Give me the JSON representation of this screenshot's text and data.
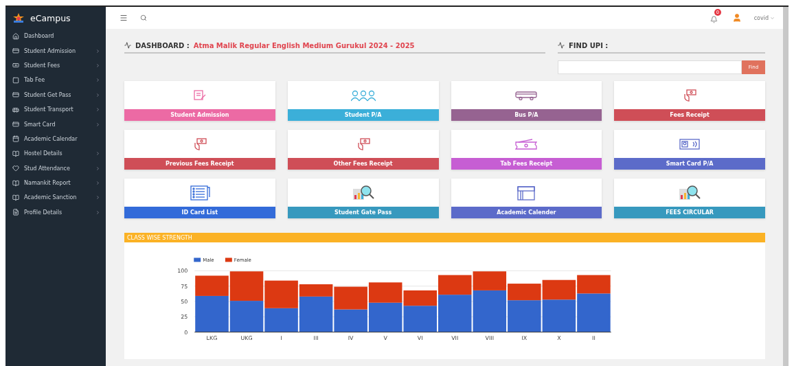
{
  "brand": "eCampus",
  "sidebar": {
    "items": [
      {
        "label": "Dashboard",
        "has_submenu": false
      },
      {
        "label": "Student Admission",
        "has_submenu": true
      },
      {
        "label": "Student Fees",
        "has_submenu": true
      },
      {
        "label": "Tab Fee",
        "has_submenu": true
      },
      {
        "label": "Student Get Pass",
        "has_submenu": true
      },
      {
        "label": "Student Transport",
        "has_submenu": true
      },
      {
        "label": "Smart Card",
        "has_submenu": true
      },
      {
        "label": "Academic Calendar",
        "has_submenu": false
      },
      {
        "label": "Hostel Details",
        "has_submenu": true
      },
      {
        "label": "Stud Attendance",
        "has_submenu": true
      },
      {
        "label": "Namankit Report",
        "has_submenu": true
      },
      {
        "label": "Academic Sanction",
        "has_submenu": true
      },
      {
        "label": "Profile Details",
        "has_submenu": true
      }
    ]
  },
  "topbar": {
    "notification_count": "0",
    "user": "covid"
  },
  "dashboard_heading": {
    "label": "DASHBOARD :",
    "school": "Atma Malik Regular English Medium Gurukul 2024 - 2025"
  },
  "find_upi": {
    "label": "FIND UPI :",
    "button": "Find"
  },
  "tiles": [
    {
      "label": "Student Admission",
      "color": "#ec6aa4"
    },
    {
      "label": "Student P/A",
      "color": "#3bafd9"
    },
    {
      "label": "Bus P/A",
      "color": "#966391"
    },
    {
      "label": "Fees Receipt",
      "color": "#cf4e57"
    },
    {
      "label": "Previous Fees Receipt",
      "color": "#cf4e57"
    },
    {
      "label": "Other Fees Receipt",
      "color": "#cf4e57"
    },
    {
      "label": "Tab Fees Receipt",
      "color": "#c65ed3"
    },
    {
      "label": "Smart Card P/A",
      "color": "#5c6bc9"
    },
    {
      "label": "ID Card List",
      "color": "#336bd9"
    },
    {
      "label": "Student Gate Pass",
      "color": "#3799be"
    },
    {
      "label": "Academic Calender",
      "color": "#5c6bc9"
    },
    {
      "label": "FEES CIRCULAR",
      "color": "#3799be"
    }
  ],
  "strength_panel": {
    "title": "CLASS WISE STRENGTH",
    "chart_data": {
      "type": "bar",
      "stacked": true,
      "categories": [
        "LKG",
        "UKG",
        "I",
        "III",
        "IV",
        "V",
        "VI",
        "VII",
        "VIII",
        "IX",
        "X",
        "II"
      ],
      "ylim": [
        0,
        100
      ],
      "yticks": [
        0,
        25,
        50,
        75,
        100
      ],
      "grid": true,
      "legend": "top",
      "series": [
        {
          "name": "Male",
          "color": "#3366cc",
          "values": [
            59,
            51,
            39,
            58,
            37,
            48,
            43,
            61,
            68,
            52,
            53,
            63
          ]
        },
        {
          "name": "Female",
          "color": "#dc3912",
          "values": [
            33,
            48,
            45,
            20,
            37,
            33,
            25,
            32,
            31,
            27,
            32,
            30
          ]
        }
      ]
    }
  }
}
